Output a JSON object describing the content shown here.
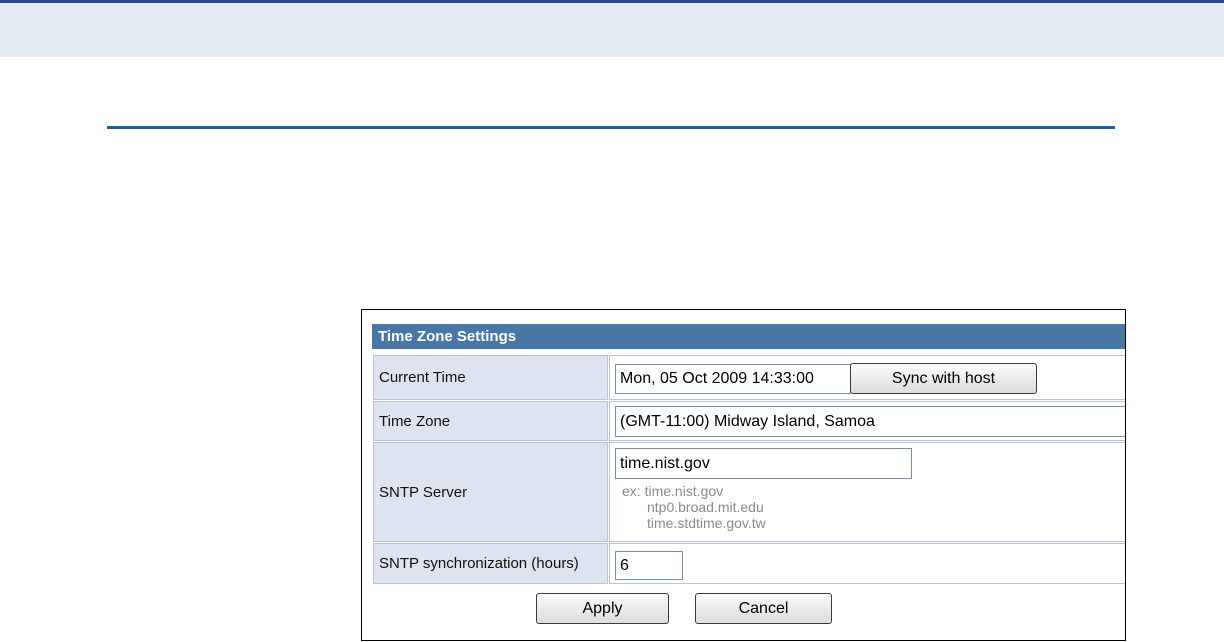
{
  "panel": {
    "title": "Time Zone Settings"
  },
  "rows": {
    "current_time": {
      "label": "Current Time",
      "value": "Mon, 05 Oct 2009 14:33:00",
      "sync_button": "Sync with host"
    },
    "time_zone": {
      "label": "Time Zone",
      "value": "(GMT-11:00) Midway Island, Samoa"
    },
    "sntp_server": {
      "label": "SNTP Server",
      "value": "time.nist.gov",
      "examples": [
        "ex: time.nist.gov",
        "ntp0.broad.mit.edu",
        "time.stdtime.gov.tw"
      ]
    },
    "sntp_sync": {
      "label": "SNTP synchronization (hours)",
      "value": "6"
    }
  },
  "actions": {
    "apply_label": "Apply",
    "cancel_label": "Cancel"
  },
  "colors": {
    "header_bar": "#4a76a5",
    "label_cell": "#dde3ef",
    "top_rule": "#1f4e8a"
  }
}
